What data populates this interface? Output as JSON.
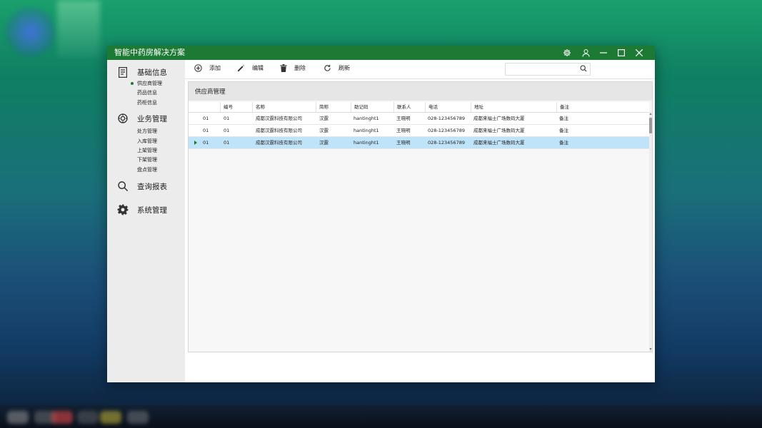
{
  "window": {
    "title": "智能中药房解决方案"
  },
  "sidebar": {
    "groups": [
      {
        "label": "基础信息",
        "icon": "document-icon",
        "items": [
          "供应商管理",
          "药品信息",
          "药柜信息"
        ],
        "active_item": 0
      },
      {
        "label": "业务管理",
        "icon": "gear-ring-icon",
        "items": [
          "处方管理",
          "入库管理",
          "上架管理",
          "下架管理",
          "盘点管理"
        ]
      },
      {
        "label": "查询报表",
        "icon": "search-icon",
        "items": []
      },
      {
        "label": "系统管理",
        "icon": "gear-icon",
        "items": []
      }
    ]
  },
  "toolbar": {
    "add_label": "添加",
    "edit_label": "编辑",
    "delete_label": "删除",
    "refresh_label": "刷新",
    "search_placeholder": ""
  },
  "panel": {
    "title": "供应商管理"
  },
  "table": {
    "columns": [
      "",
      "编号",
      "名称",
      "简称",
      "助记码",
      "联系人",
      "电话",
      "地址",
      "备注"
    ],
    "rows": [
      [
        "01",
        "01",
        "成都汉霆科技有限公司",
        "汉霆",
        "hantinght1",
        "王晓明",
        "028-123456789",
        "成都来福士广场数码大厦",
        "备注"
      ],
      [
        "01",
        "01",
        "成都汉霆科技有限公司",
        "汉霆",
        "hantinght1",
        "王晓明",
        "028-123456789",
        "成都来福士广场数码大厦",
        "备注"
      ],
      [
        "01",
        "01",
        "成都汉霆科技有限公司",
        "汉霆",
        "hantinght1",
        "王晓明",
        "028-123456789",
        "成都来福士广场数码大厦",
        "备注"
      ]
    ],
    "selected_row": 2
  },
  "colors": {
    "titlebar": "#1c7a34",
    "selected_row": "#bfe3f8",
    "sidebar": "#ececec"
  }
}
